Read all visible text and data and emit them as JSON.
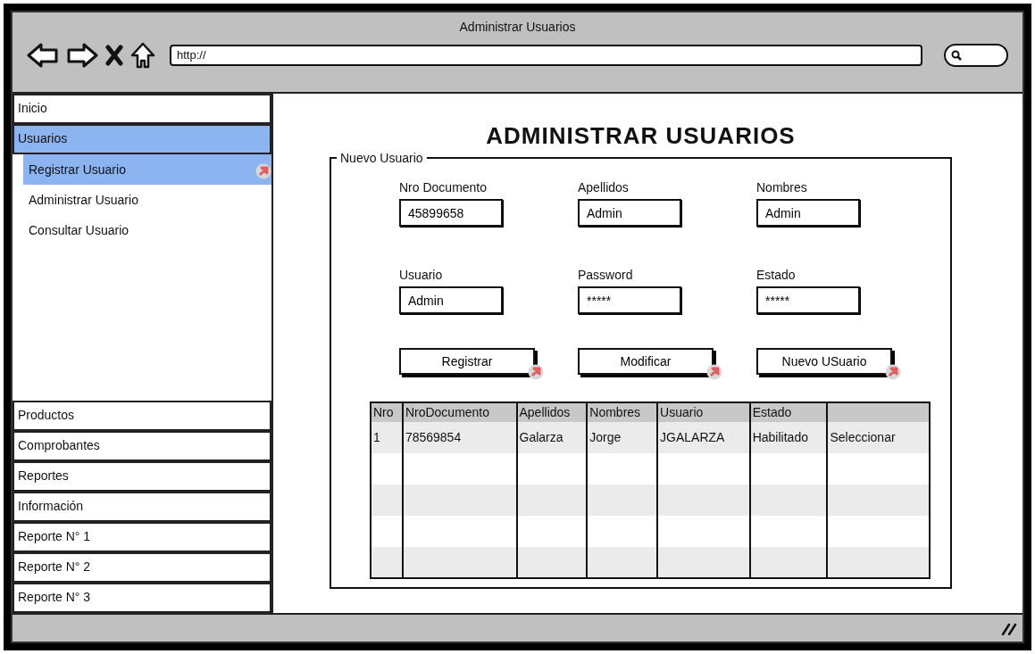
{
  "window": {
    "title": "Administrar Usuarios"
  },
  "address_bar": {
    "value": "http://"
  },
  "sidebar": {
    "items": [
      {
        "label": "Inicio",
        "selected": false
      },
      {
        "label": "Usuarios",
        "selected": true,
        "children": [
          {
            "label": "Registrar Usuario",
            "selected": true,
            "link": true
          },
          {
            "label": "Administrar Usuario",
            "selected": false,
            "link": false
          },
          {
            "label": "Consultar Usuario",
            "selected": false,
            "link": false
          }
        ]
      },
      {
        "label": "Productos",
        "selected": false
      },
      {
        "label": "Comprobantes",
        "selected": false
      },
      {
        "label": "Reportes",
        "selected": false
      },
      {
        "label": "Información",
        "selected": false
      },
      {
        "label": "Reporte N° 1",
        "selected": false
      },
      {
        "label": "Reporte N° 2",
        "selected": false
      },
      {
        "label": "Reporte N° 3",
        "selected": false
      }
    ]
  },
  "heading": "ADMINISTRAR USUARIOS",
  "form": {
    "legend": "Nuevo Usuario",
    "fields": [
      {
        "label": "Nro Documento",
        "value": "45899658"
      },
      {
        "label": "Apellidos",
        "value": "Admin"
      },
      {
        "label": "Nombres",
        "value": "Admin"
      },
      {
        "label": "Usuario",
        "value": "Admin"
      },
      {
        "label": "Password",
        "value": "*****"
      },
      {
        "label": "Estado",
        "value": "*****"
      }
    ],
    "buttons": [
      {
        "label": "Registrar",
        "link": true
      },
      {
        "label": "Modificar",
        "link": true
      },
      {
        "label": "Nuevo USuario",
        "link": true
      }
    ]
  },
  "table": {
    "columns": [
      "Nro",
      "NroDocumento",
      "Apellidos",
      "Nombres",
      "Usuario",
      "Estado"
    ],
    "rows": [
      [
        "1",
        "78569854",
        "Galarza",
        "Jorge",
        "JGALARZA",
        "Habilitado",
        "Seleccionar"
      ]
    ]
  }
}
